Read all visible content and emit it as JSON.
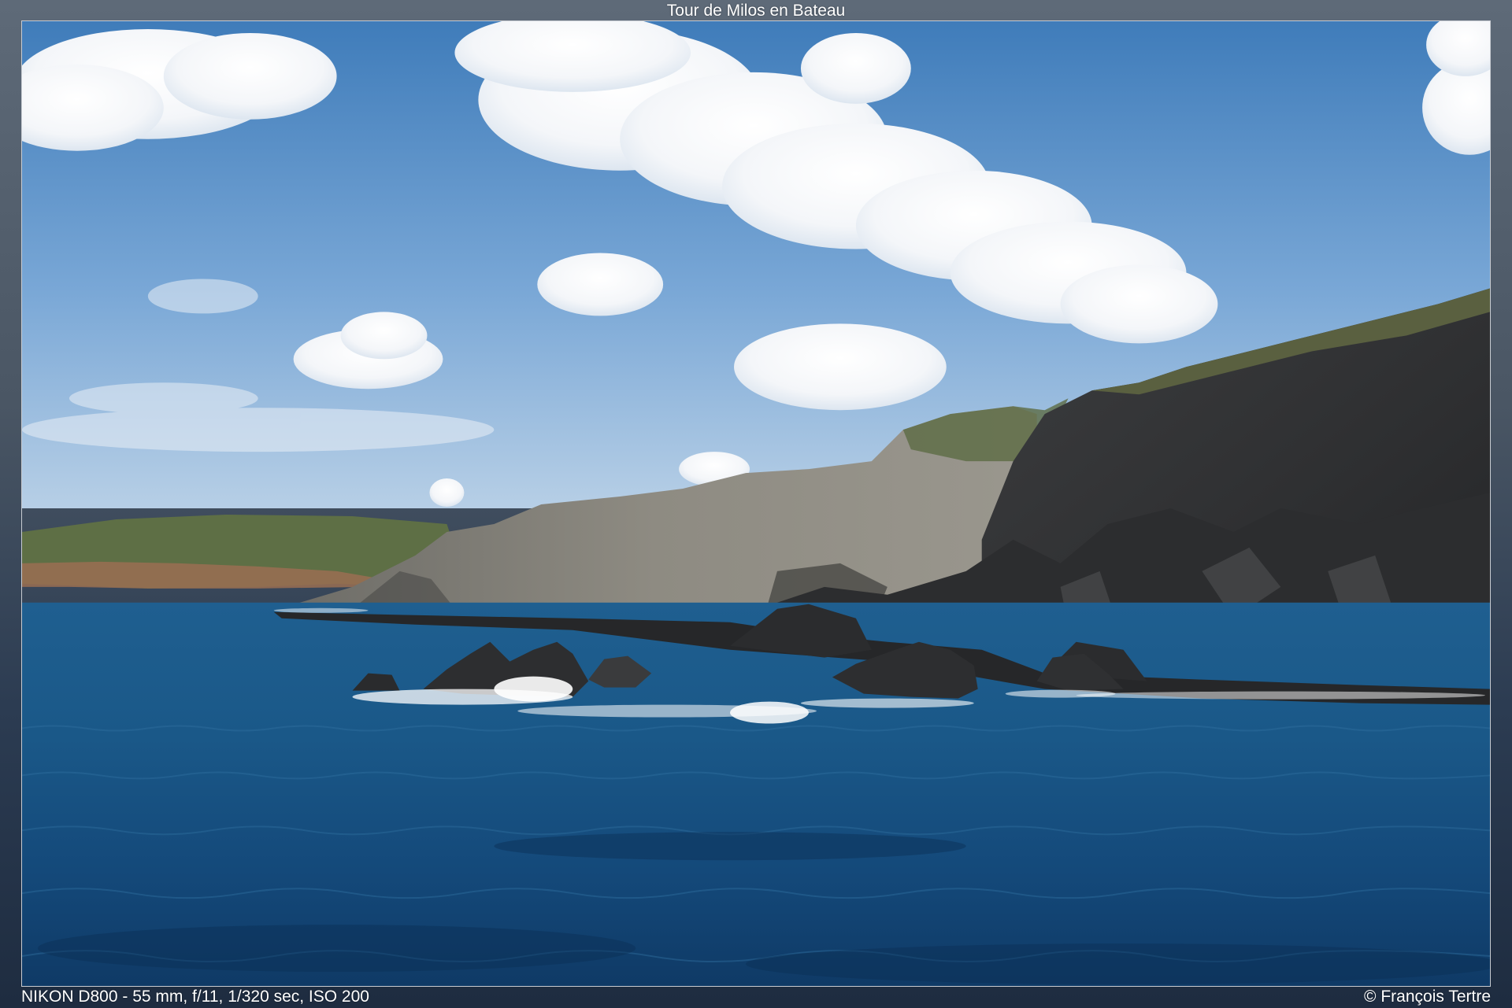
{
  "viewer": {
    "title": "Tour de Milos en Bateau",
    "exif": "NIKON D800 - 55 mm, f/11, 1/320 sec, ISO 200",
    "copyright": "© François Tertre"
  },
  "photo": {
    "subject": "sea-cliffs-rocks-clouds",
    "colors": {
      "sky_top": "#4f86c0",
      "sky_bottom": "#a9c8e6",
      "sea_far": "#1d5a8c",
      "sea_near": "#0f3a66",
      "cliff_dark": "#2f3032",
      "cliff_light": "#8f8c84",
      "vegetation": "#5c6a44",
      "cloud": "#ffffff"
    }
  }
}
